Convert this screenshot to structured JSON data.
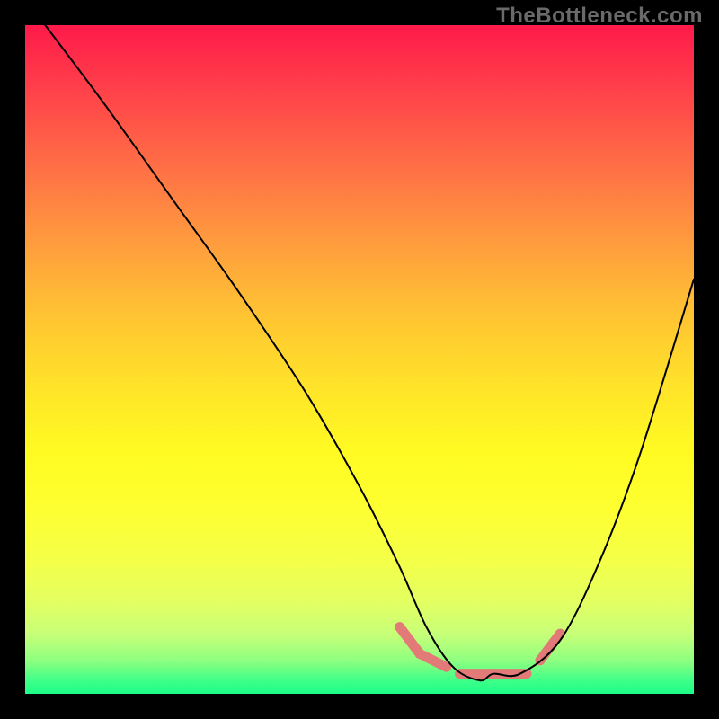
{
  "watermark": "TheBottleneck.com",
  "chart_data": {
    "type": "line",
    "title": "",
    "xlabel": "",
    "ylabel": "",
    "xlim": [
      0,
      100
    ],
    "ylim": [
      0,
      100
    ],
    "series": [
      {
        "name": "curve",
        "color": "#000000",
        "x": [
          3,
          12,
          22,
          32,
          42,
          50,
          56,
          60,
          64,
          68,
          70,
          74,
          80,
          86,
          92,
          100
        ],
        "values": [
          100,
          88,
          74,
          60,
          45,
          31,
          19,
          10,
          4,
          2,
          3,
          3,
          8,
          20,
          36,
          62
        ]
      }
    ],
    "highlight_band": {
      "color": "#e27a77",
      "segments": [
        {
          "x0": 56,
          "y0": 10,
          "x1": 59,
          "y1": 6
        },
        {
          "x0": 59,
          "y0": 6,
          "x1": 63,
          "y1": 4
        },
        {
          "x0": 65,
          "y0": 3,
          "x1": 70,
          "y1": 3
        },
        {
          "x0": 70,
          "y0": 3,
          "x1": 75,
          "y1": 3
        },
        {
          "x0": 77,
          "y0": 5,
          "x1": 80,
          "y1": 9
        }
      ]
    }
  },
  "colors": {
    "gradient_top": "#ff1a4a",
    "gradient_bottom": "#1bfd88",
    "frame": "#000000",
    "watermark": "#6a6a6a"
  }
}
